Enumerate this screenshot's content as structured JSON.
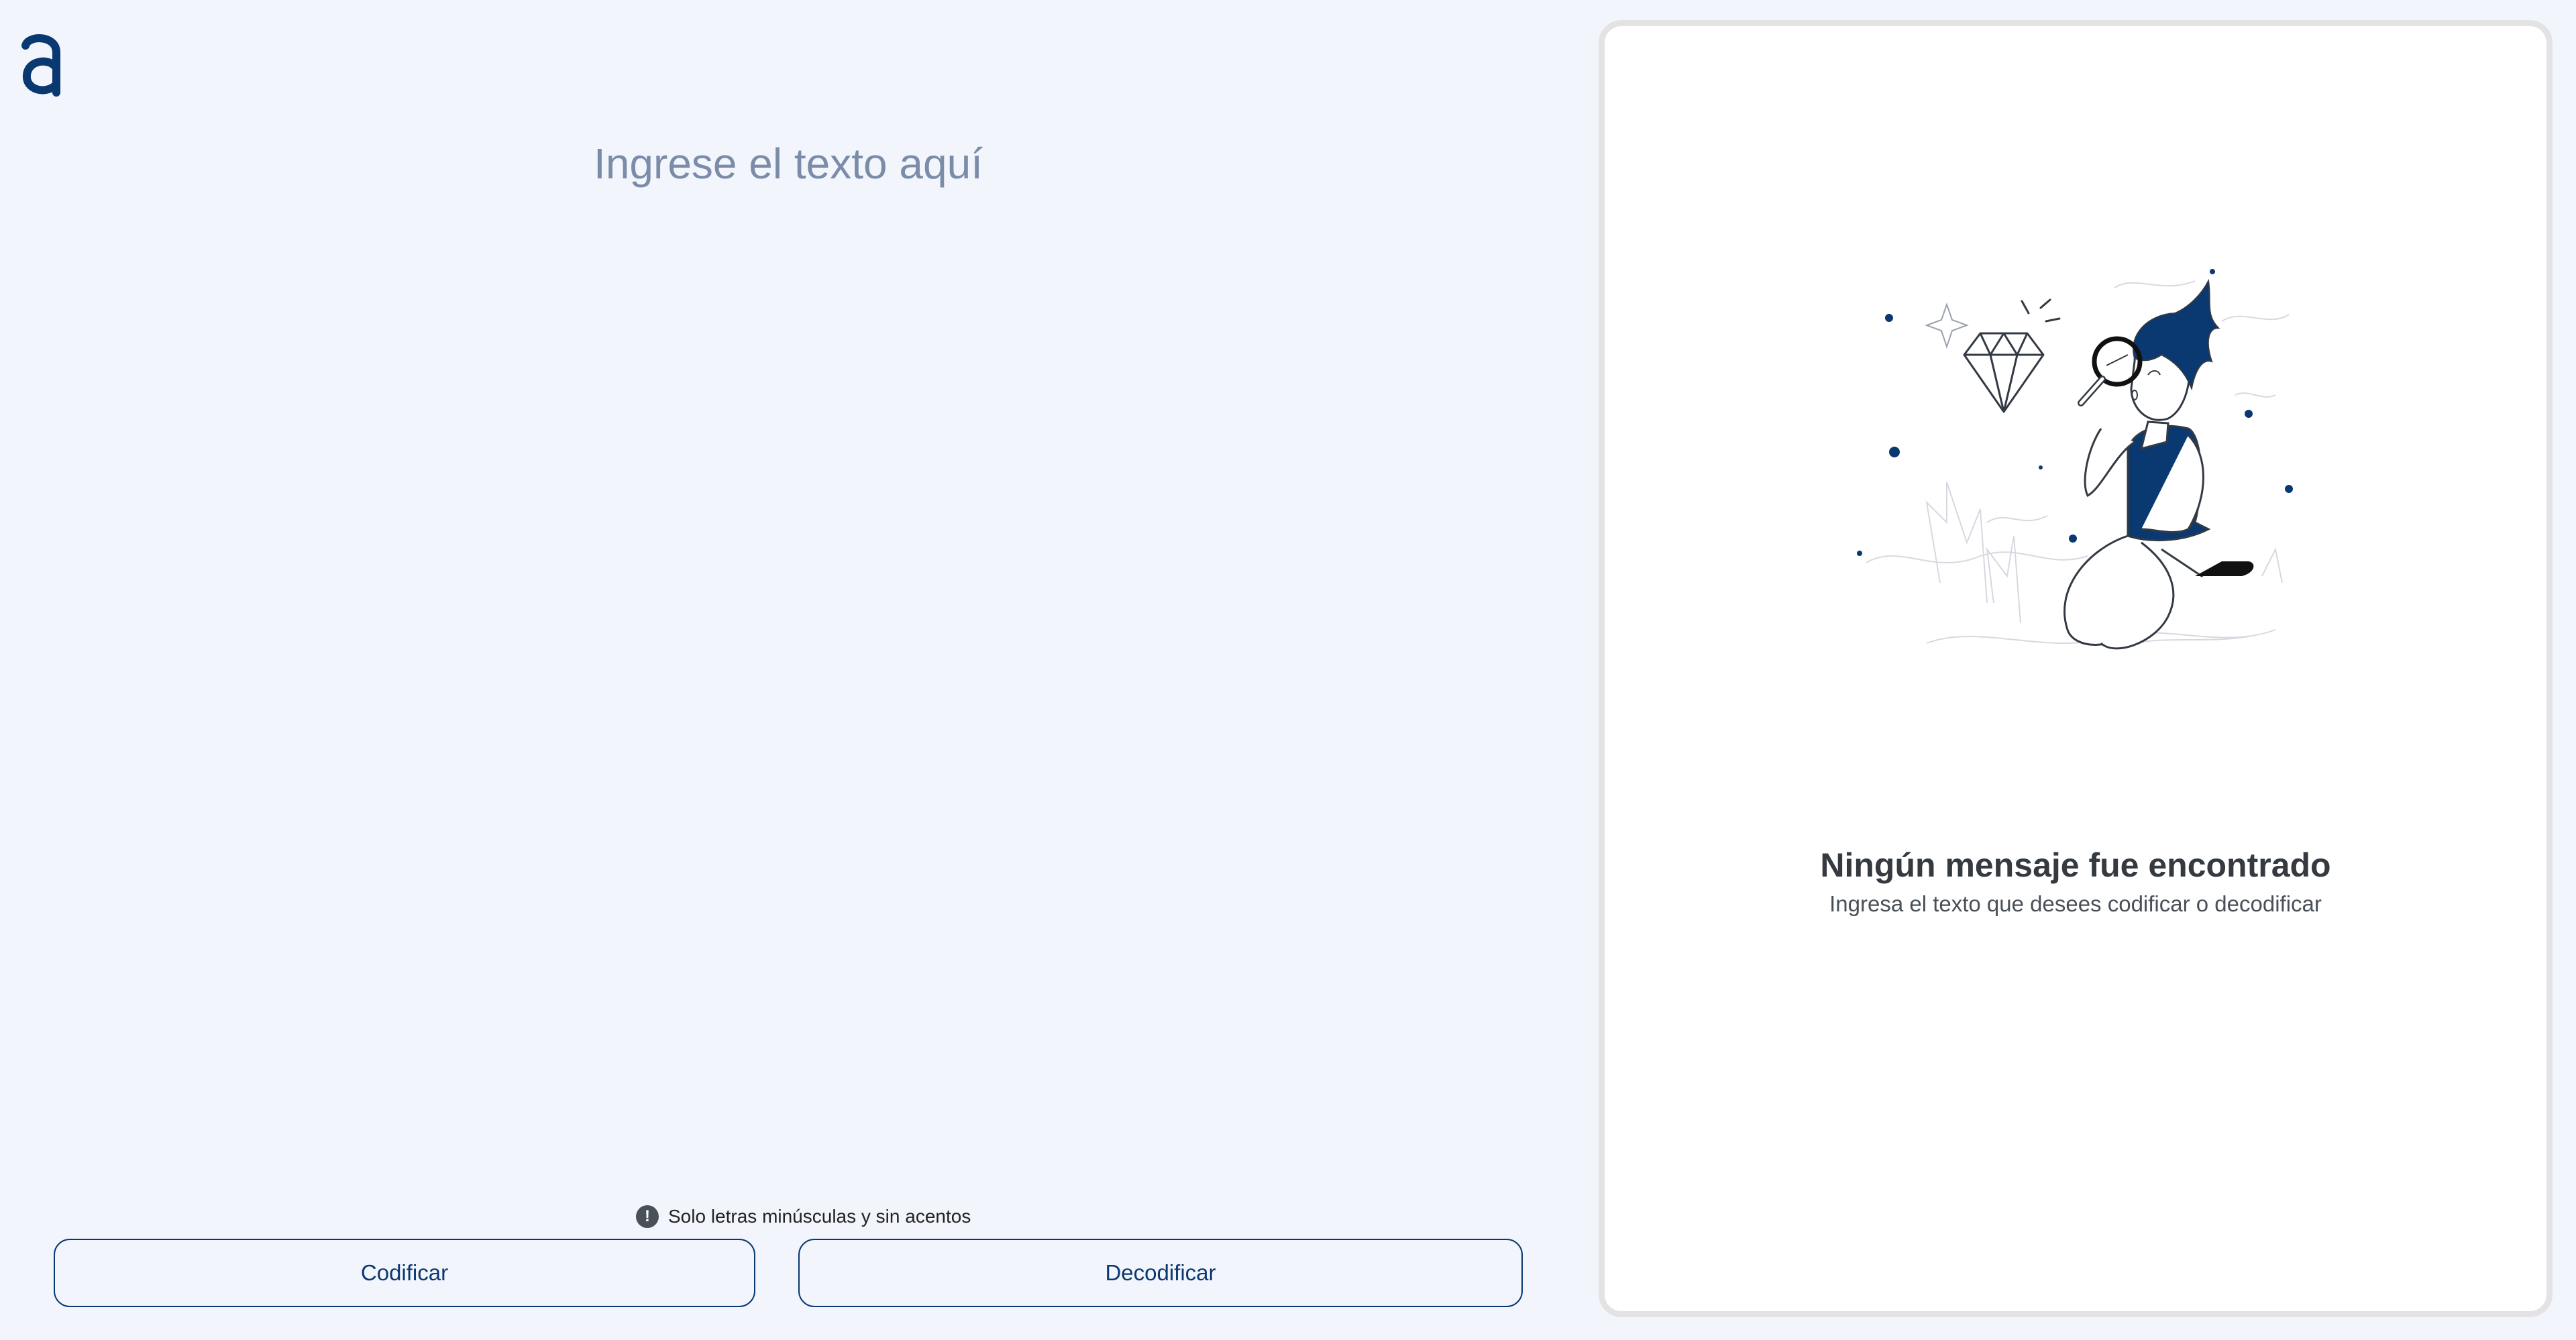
{
  "brand": {
    "logo_icon": "alura-a-logo-icon",
    "color": "#0a3871"
  },
  "editor": {
    "placeholder": "Ingrese el texto aquí",
    "value": ""
  },
  "hint": {
    "icon": "exclamation-circle-icon",
    "text": "Solo letras minúsculas y sin acentos"
  },
  "actions": {
    "encode_label": "Codificar",
    "decode_label": "Decodificar"
  },
  "output": {
    "illustration": "person-with-magnifier-inspecting-diamond-illustration",
    "empty_title": "Ningún mensaje fue encontrado",
    "empty_subtitle": "Ingresa el texto que desees codificar o decodificar"
  },
  "colors": {
    "background": "#f3f5fc",
    "accent": "#0a3871",
    "placeholder": "#7a8ca8",
    "panel_border": "#e3e3e3"
  }
}
